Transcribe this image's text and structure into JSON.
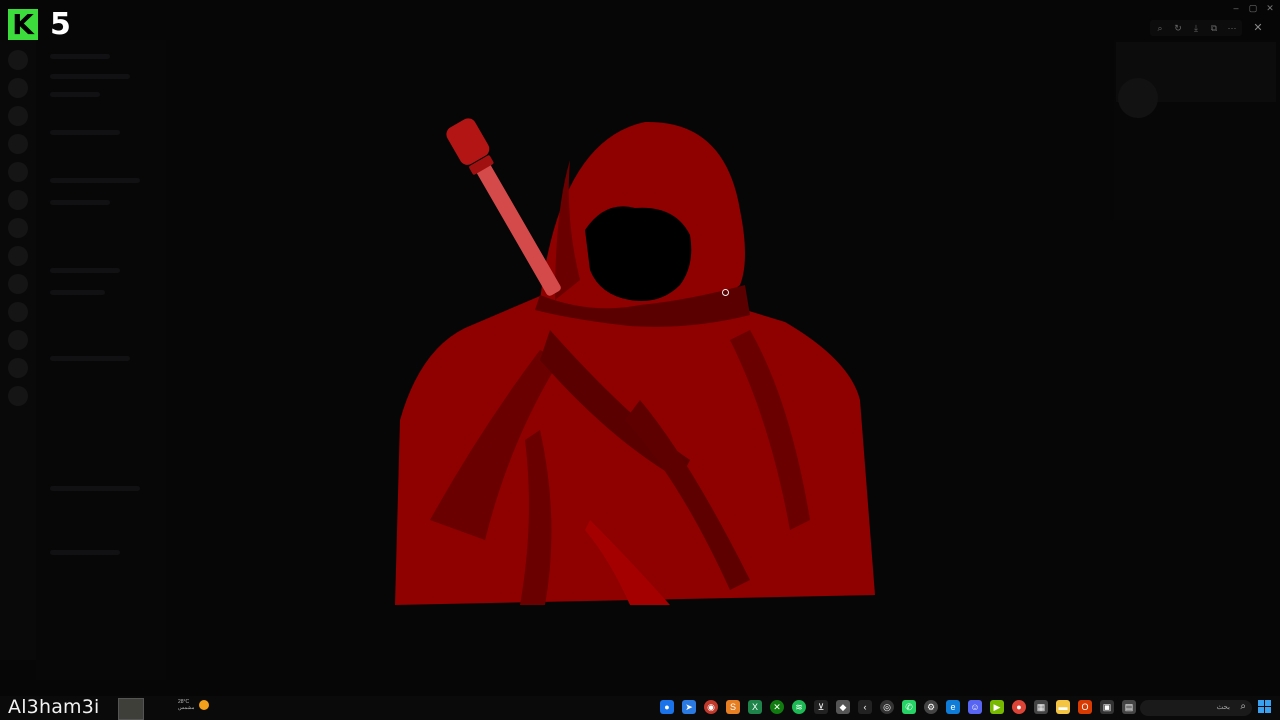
{
  "logo": {
    "letter": "K",
    "number": "5"
  },
  "window": {
    "controls": [
      "–",
      "▢",
      "✕"
    ]
  },
  "image_viewer": {
    "toolbar_icons": [
      "zoom-icon",
      "rotate-icon",
      "download-icon",
      "open-external-icon",
      "more-icon"
    ],
    "close_icon": "close-icon"
  },
  "artwork": {
    "subject": "hooded-figure",
    "colors": {
      "cloak": "#8f0000",
      "cloak_shadow": "#5a0000",
      "cloak_light": "#a40000",
      "sword_grip": "#d44a4a",
      "pommel": "#b31515"
    }
  },
  "taskbar": {
    "handle": "Al3ham3i",
    "weather": {
      "temp": "28°C",
      "condition": "مشمس"
    },
    "search": {
      "placeholder": "بحث"
    },
    "apps": [
      "chrome-icon",
      "paper-plane-icon",
      "record-icon",
      "sublime-icon",
      "excel-icon",
      "xbox-icon",
      "spotify-icon",
      "capcut-icon",
      "game-icon",
      "back-arrow-icon",
      "obs-icon",
      "whatsapp-icon",
      "settings-icon",
      "edge-icon",
      "discord-icon",
      "nvidia-icon",
      "chrome-icon",
      "calculator-icon",
      "folder-icon",
      "office-icon",
      "store-icon",
      "files-icon"
    ],
    "colors": {
      "accent": "#3aa0f0"
    }
  }
}
